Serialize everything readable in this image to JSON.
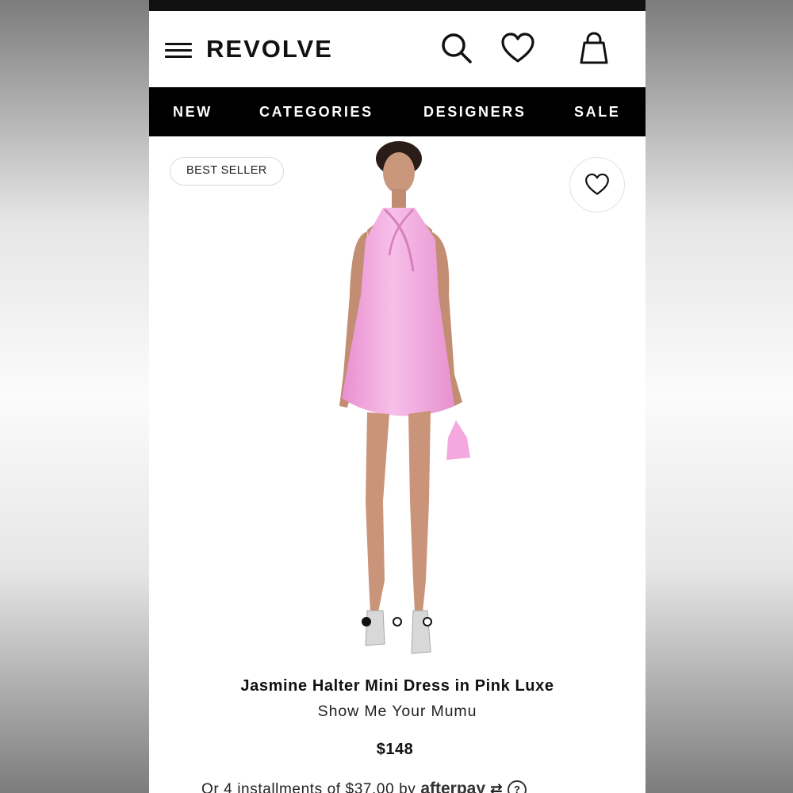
{
  "header": {
    "brand_logo": "REVOLVE",
    "icons": [
      "menu-icon",
      "search-icon",
      "heart-icon",
      "shopping-bag-icon"
    ]
  },
  "nav": {
    "items": [
      {
        "label": "NEW"
      },
      {
        "label": "CATEGORIES"
      },
      {
        "label": "DESIGNERS"
      },
      {
        "label": "SALE"
      }
    ]
  },
  "product": {
    "badge": "BEST SELLER",
    "title": "Jasmine Halter Mini Dress in Pink Luxe",
    "brand": "Show Me Your Mumu",
    "price": "$148",
    "installments_text": "Or 4 installments of $37.00 by",
    "payment_provider": "afterpay",
    "help_symbol": "?",
    "dress_color": "#f3a8df",
    "carousel": {
      "total": 3,
      "active": 1
    }
  },
  "colors": {
    "nav_background": "#000000",
    "status_bar": "#111111",
    "accent": "#111111"
  }
}
